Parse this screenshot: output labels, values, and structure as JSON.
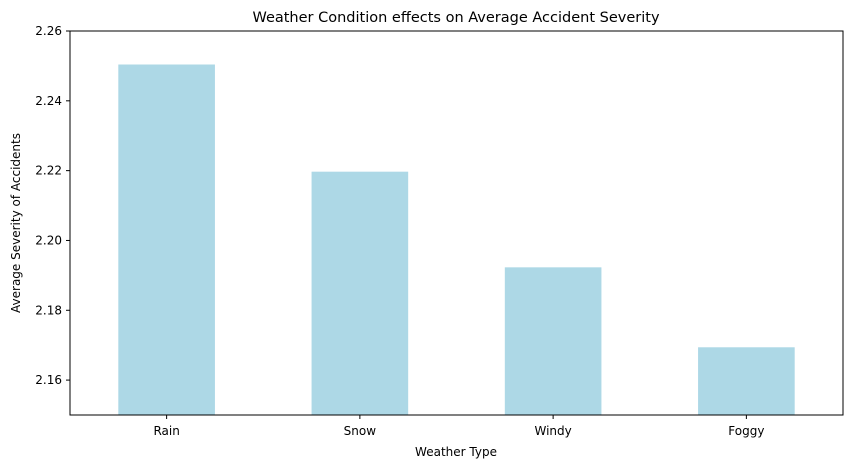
{
  "chart_data": {
    "type": "bar",
    "title": "Weather Condition effects on Average Accident Severity",
    "xlabel": "Weather Type",
    "ylabel": "Average Severity of Accidents",
    "categories": [
      "Rain",
      "Snow",
      "Windy",
      "Foggy"
    ],
    "values": [
      2.2504,
      2.2197,
      2.1923,
      2.1694
    ],
    "ylim": [
      2.15,
      2.26
    ],
    "yticks": [
      2.16,
      2.18,
      2.2,
      2.22,
      2.24,
      2.26
    ],
    "ytick_labels": [
      "2.16",
      "2.18",
      "2.20",
      "2.22",
      "2.24",
      "2.26"
    ],
    "bar_color": "#add8e6",
    "grid": false,
    "legend": "none"
  }
}
